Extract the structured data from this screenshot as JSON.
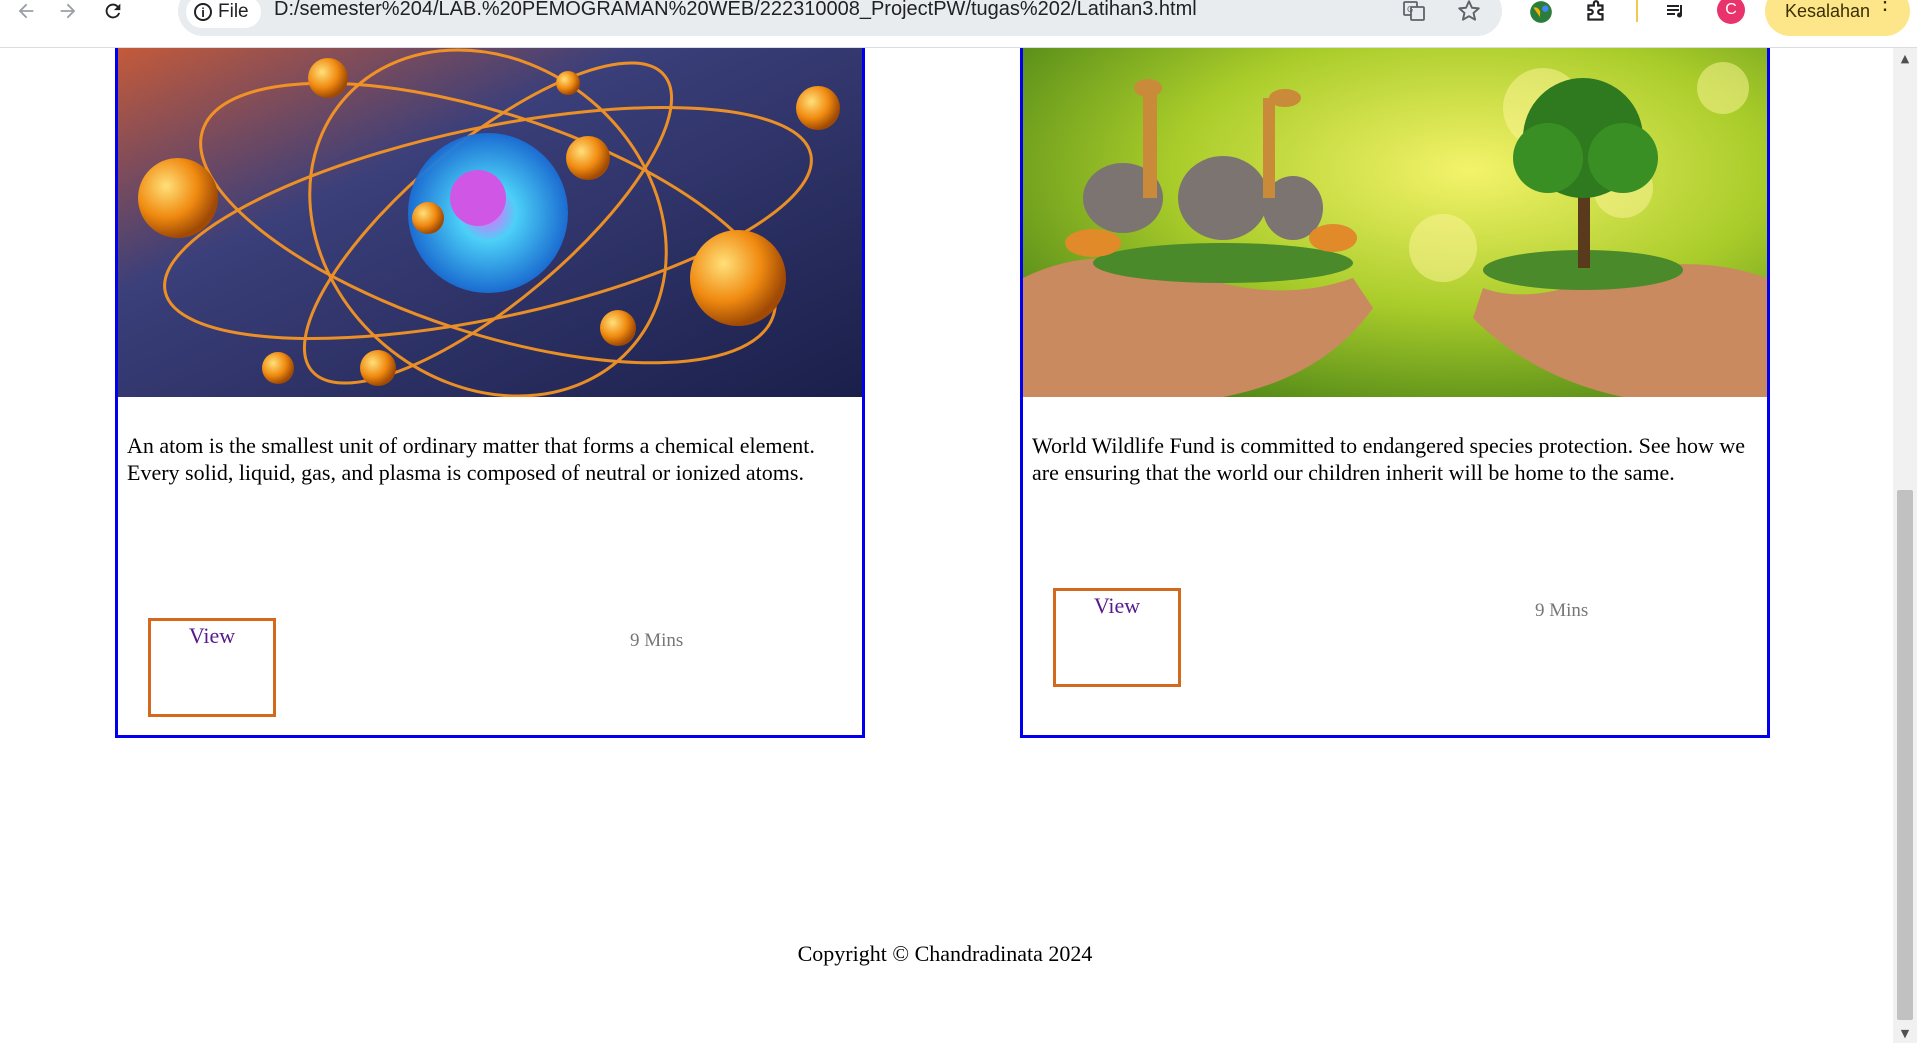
{
  "browser": {
    "scheme_label": "File",
    "url": "D:/semester%204/LAB.%20PEMOGRAMAN%20WEB/222310008_ProjectPW/tugas%202/Latihan3.html",
    "profile_initial": "C",
    "error_button_label": "Kesalahan",
    "icons": [
      "back-arrow-icon",
      "forward-arrow-icon",
      "reload-icon",
      "info-icon",
      "translate-icon",
      "bookmark-star-icon",
      "extension-globe-icon",
      "puzzle-icon",
      "reading-list-icon",
      "more-vert-icon"
    ]
  },
  "cards": [
    {
      "image_subject": "atom",
      "text": "An atom is the smallest unit of ordinary matter that forms a chemical element. Every solid, liquid, gas, and plasma is composed of neutral or ionized atoms.",
      "view_label": "View",
      "duration": "9 Mins"
    },
    {
      "image_subject": "wildlife",
      "text": "World Wildlife Fund is committed to endangered species protection. See how we are ensuring that the world our children inherit will be home to the same.",
      "view_label": "View",
      "duration": "9 Mins"
    }
  ],
  "footer": {
    "copyright": "Copyright © Chandradinata 2024"
  },
  "colors": {
    "card_border": "#0000ee",
    "view_border": "#d2691e",
    "link_visited": "#551a8b",
    "error_chip": "#fde68a",
    "avatar": "#e8336d"
  }
}
